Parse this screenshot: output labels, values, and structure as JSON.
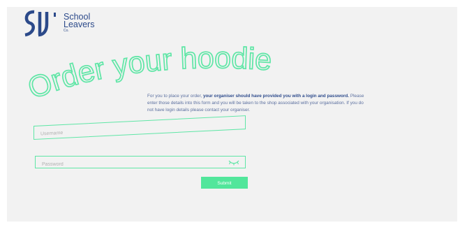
{
  "brand": {
    "line1": "School",
    "line2": "Leavers",
    "line3": "Co."
  },
  "headline": "Order your hoodie",
  "intro": {
    "part1": "For you to place your order, ",
    "bold": "your organiser should have provided you with a login and password.",
    "part2": " Please enter those details into this form and you will be taken to the shop associated with your organisation. If you do not have login details please contact your organiser."
  },
  "form": {
    "username_placeholder": "Username",
    "password_placeholder": "Password",
    "submit_label": "Submit"
  },
  "colors": {
    "accent": "#52e69b",
    "brand": "#2c4a8a"
  },
  "icons": {
    "password_toggle": "eye-closed-icon"
  }
}
